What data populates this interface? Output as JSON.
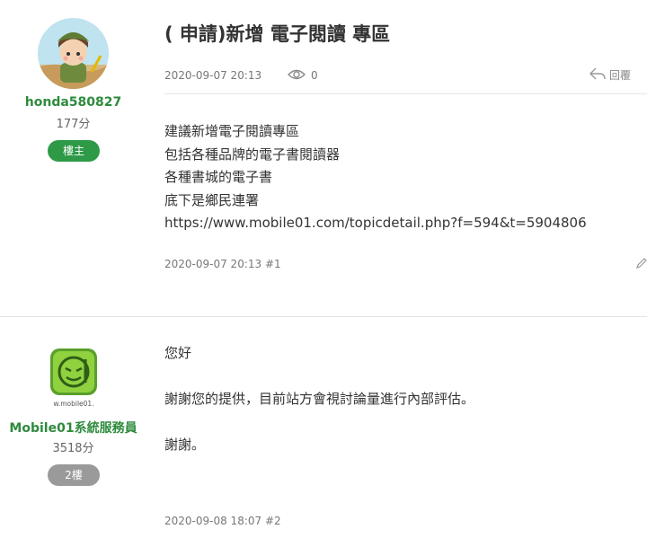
{
  "thread": {
    "title": "( 申請)新增 電子閱讀 專區",
    "date": "2020-09-07 20:13",
    "views": "0",
    "reply_label": "回覆"
  },
  "posts": [
    {
      "author": "honda580827",
      "points": "177分",
      "badge": "樓主",
      "content": [
        "建議新增電子閱讀專區",
        "包括各種品牌的電子書閱讀器",
        "各種書城的電子書",
        "底下是鄉民連署",
        "https://www.mobile01.com/topicdetail.php?f=594&t=5904806"
      ],
      "footer": "2020-09-07 20:13 #1"
    },
    {
      "author": "Mobile01系統服務員",
      "points": "3518分",
      "badge": "2樓",
      "avatar_text": "w.mobile01.",
      "content": [
        "您好",
        "",
        "謝謝您的提供，目前站方會視討論量進行內部評估。",
        "",
        "謝謝。"
      ],
      "footer": "2020-09-08 18:07 #2"
    }
  ],
  "colors": {
    "accent_green": "#2e8b3d",
    "badge_green": "#2e9a48",
    "badge_gray": "#9a9a9a"
  },
  "icons": {
    "views": "eye-icon",
    "reply": "reply-arrow-icon",
    "edit": "pencil-icon"
  }
}
